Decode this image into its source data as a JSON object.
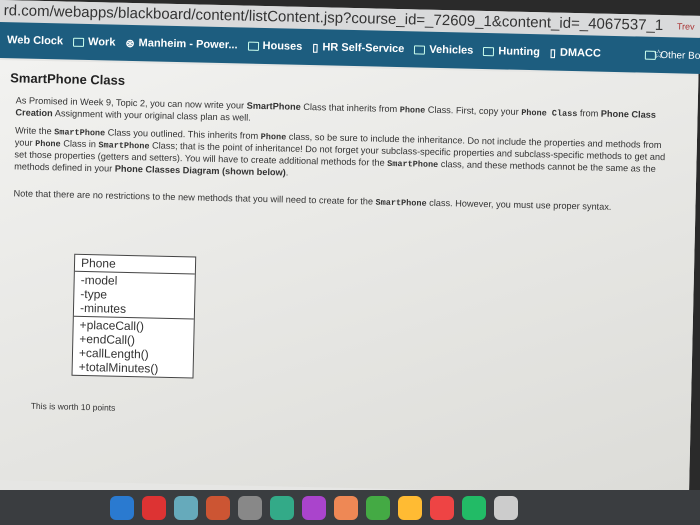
{
  "browser": {
    "url": "rd.com/webapps/blackboard/content/listContent.jsp?course_id=_72609_1&content_id=_4067537_1",
    "extension_label": "Trev",
    "bookmarks": [
      "Web Clock",
      "Work",
      "Manheim - Power...",
      "Houses",
      "HR Self-Service",
      "Vehicles",
      "Hunting",
      "DMACC"
    ],
    "other_bookmarks": "Other Book"
  },
  "page": {
    "title": "SmartPhone Class",
    "p1": {
      "a": "As Promised in Week 9, Topic 2, you can now write your ",
      "b": "SmartPhone",
      "c": " Class that inherits from ",
      "d": "Phone",
      "e": " Class. First, copy your ",
      "f": "Phone Class",
      "g": " from ",
      "h": "Phone Class Creation",
      "i": " Assignment with your original class plan as well."
    },
    "p2": {
      "a": "Write the ",
      "b": "SmartPhone",
      "c": " Class you outlined. This inherits from ",
      "d": "Phone",
      "e": " class, so be sure to include the inheritance. Do not include the properties and methods from your ",
      "f": "Phone",
      "g": " Class in ",
      "h": "SmartPhone",
      "i": " Class; that is the point of inheritance! Do not forget your subclass-specific properties and subclass-specific methods to get and set those properties (getters and setters). You will have to create additional methods for the ",
      "j": "SmartPhone",
      "k": " class, and these methods cannot be the same as the methods defined in your ",
      "l": "Phone Classes Diagram (shown below)",
      "m": "."
    },
    "p3": {
      "a": "Note that there are no restrictions to the new methods that you will need to create for the ",
      "b": "SmartPhone",
      "c": " class. However, you must use proper syntax."
    },
    "uml": {
      "name": "Phone",
      "attributes": [
        "-model",
        "-type",
        "-minutes"
      ],
      "methods": [
        "+placeCall()",
        "+endCall()",
        "+callLength()",
        "+totalMinutes()"
      ]
    },
    "worth": "This is worth 10 points"
  },
  "dock_colors": [
    "#2a7ad0",
    "#d33",
    "#6ab",
    "#c53",
    "#888",
    "#3a8",
    "#a4c",
    "#e85",
    "#4a4",
    "#fb3",
    "#e44",
    "#2b6",
    "#ccc"
  ]
}
